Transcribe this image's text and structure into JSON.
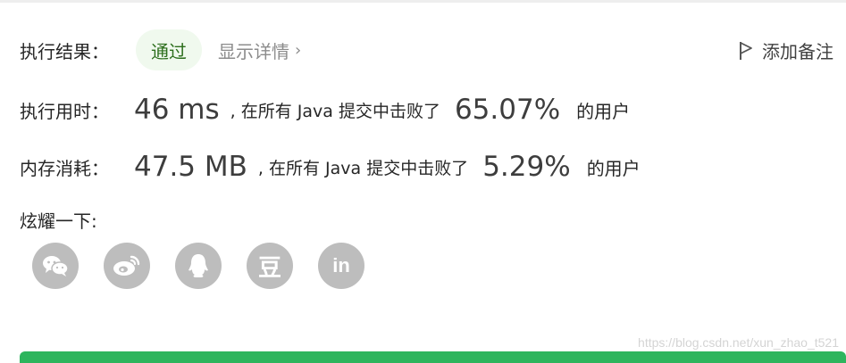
{
  "result": {
    "label": "执行结果：",
    "status": "通过",
    "details_link": "显示详情",
    "add_note": "添加备注"
  },
  "runtime": {
    "label": "执行用时：",
    "value": "46 ms",
    "middle_text": ", 在所有 Java 提交中击败了",
    "percent": "65.07%",
    "tail": "的用户"
  },
  "memory": {
    "label": "内存消耗：",
    "value": "47.5 MB",
    "middle_text": ", 在所有 Java 提交中击败了",
    "percent": "5.29%",
    "tail": "的用户"
  },
  "share": {
    "label": "炫耀一下:",
    "buttons": [
      {
        "icon": "wechat-icon"
      },
      {
        "icon": "weibo-icon"
      },
      {
        "icon": "qq-icon"
      },
      {
        "icon": "douban-icon",
        "glyph": "豆"
      },
      {
        "icon": "linkedin-icon",
        "glyph": "in"
      }
    ]
  },
  "watermark": "https://blog.csdn.net/xun_zhao_t521",
  "colors": {
    "status_bg": "#f0f9ee",
    "status_text": "#2c6e1c",
    "icon_gray": "#bdbdbd",
    "bar_green": "#2db55d"
  }
}
